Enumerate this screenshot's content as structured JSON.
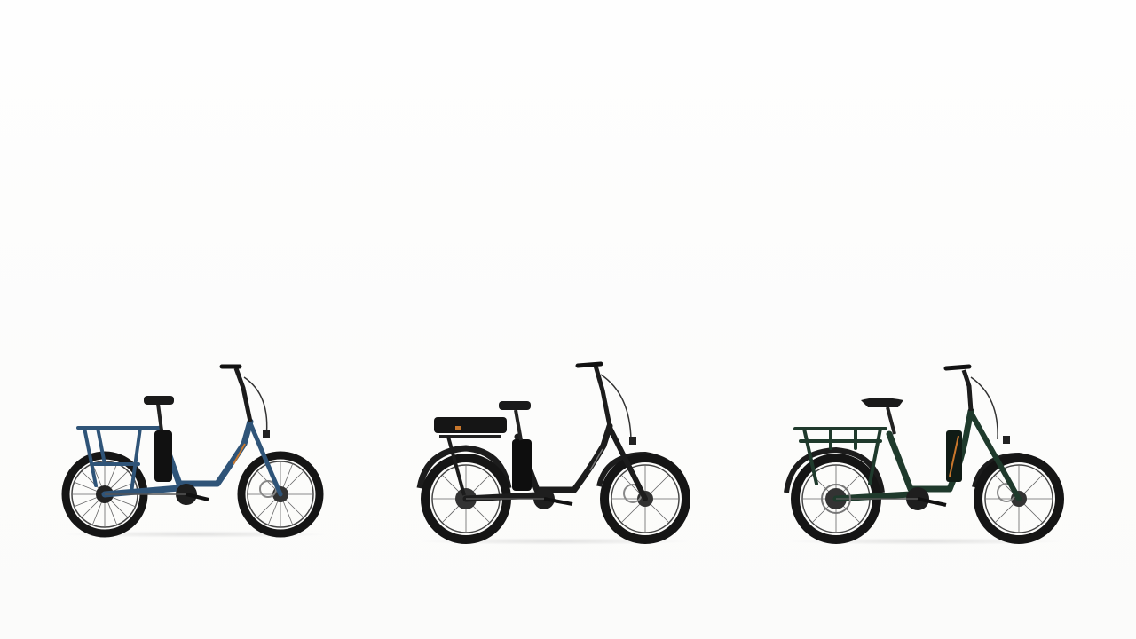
{
  "scene": {
    "background": "#fdfdfc"
  },
  "bikes": [
    {
      "frame_color": "#2f5478",
      "accent_color": "#c8772c",
      "style": "cargo-rear-rack"
    },
    {
      "frame_color": "#1c1c1c",
      "accent_color": "#c8772c",
      "style": "long-bench-seat"
    },
    {
      "frame_color": "#1f3a2c",
      "accent_color": "#c8772c",
      "style": "cargo-rear-rack"
    }
  ]
}
